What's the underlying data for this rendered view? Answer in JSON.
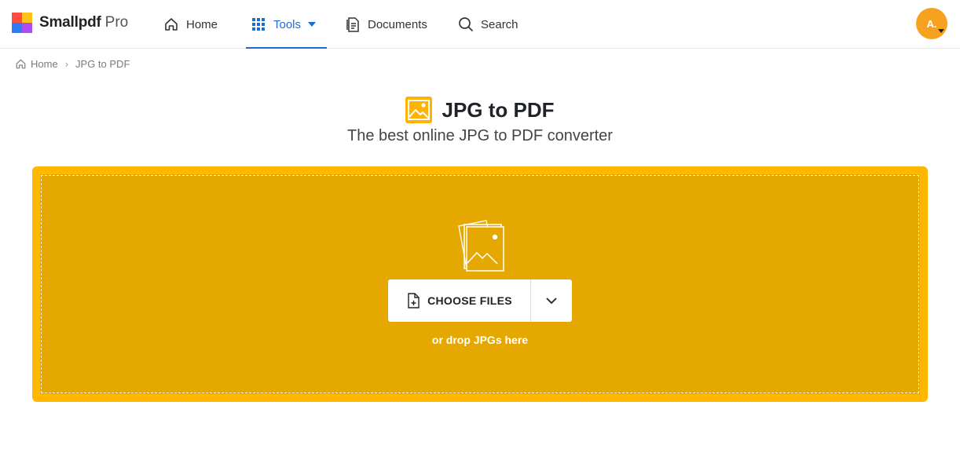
{
  "brand": {
    "name": "Smallpdf",
    "tier": "Pro"
  },
  "nav": {
    "home": "Home",
    "tools": "Tools",
    "documents": "Documents",
    "search": "Search"
  },
  "user": {
    "initials": "A."
  },
  "breadcrumb": {
    "home": "Home",
    "separator": "›",
    "current": "JPG to PDF"
  },
  "page": {
    "title": "JPG to PDF",
    "subtitle": "The best online JPG to PDF converter"
  },
  "dropzone": {
    "choose_label": "CHOOSE FILES",
    "hint": "or drop JPGs here"
  },
  "colors": {
    "accent_blue": "#1e6bd6",
    "dropzone_fill": "#e5a800",
    "dropzone_border": "#ffb700",
    "avatar": "#f6a21e"
  },
  "icons": [
    "home-icon",
    "grid-icon",
    "documents-icon",
    "search-icon",
    "image-file-icon",
    "upload-illustration-icon",
    "file-add-icon",
    "chevron-down-icon"
  ]
}
